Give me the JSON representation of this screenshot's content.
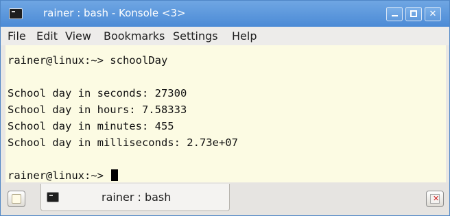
{
  "window": {
    "title": "rainer : bash - Konsole <3>",
    "accent": "#4c8bd6"
  },
  "title_buttons": {
    "minimize_icon": "minimize-icon",
    "maximize_icon": "maximize-icon",
    "close_icon": "close-icon",
    "close_glyph": "✕"
  },
  "menu": [
    "File",
    "Edit",
    "View",
    "Bookmarks",
    "Settings",
    "Help"
  ],
  "terminal": {
    "background": "#fcfbe3",
    "lines": [
      "rainer@linux:~> schoolDay",
      "",
      "School day in seconds: 27300",
      "School day in hours: 7.58333",
      "School day in minutes: 455",
      "School day in milliseconds: 2.73e+07",
      "",
      "rainer@linux:~> "
    ]
  },
  "tabs": [
    {
      "label": "rainer : bash",
      "icon": "terminal-icon"
    }
  ],
  "tabbar": {
    "new_tab_icon": "new-tab-icon",
    "close_tab_icon": "close-tab-icon"
  }
}
